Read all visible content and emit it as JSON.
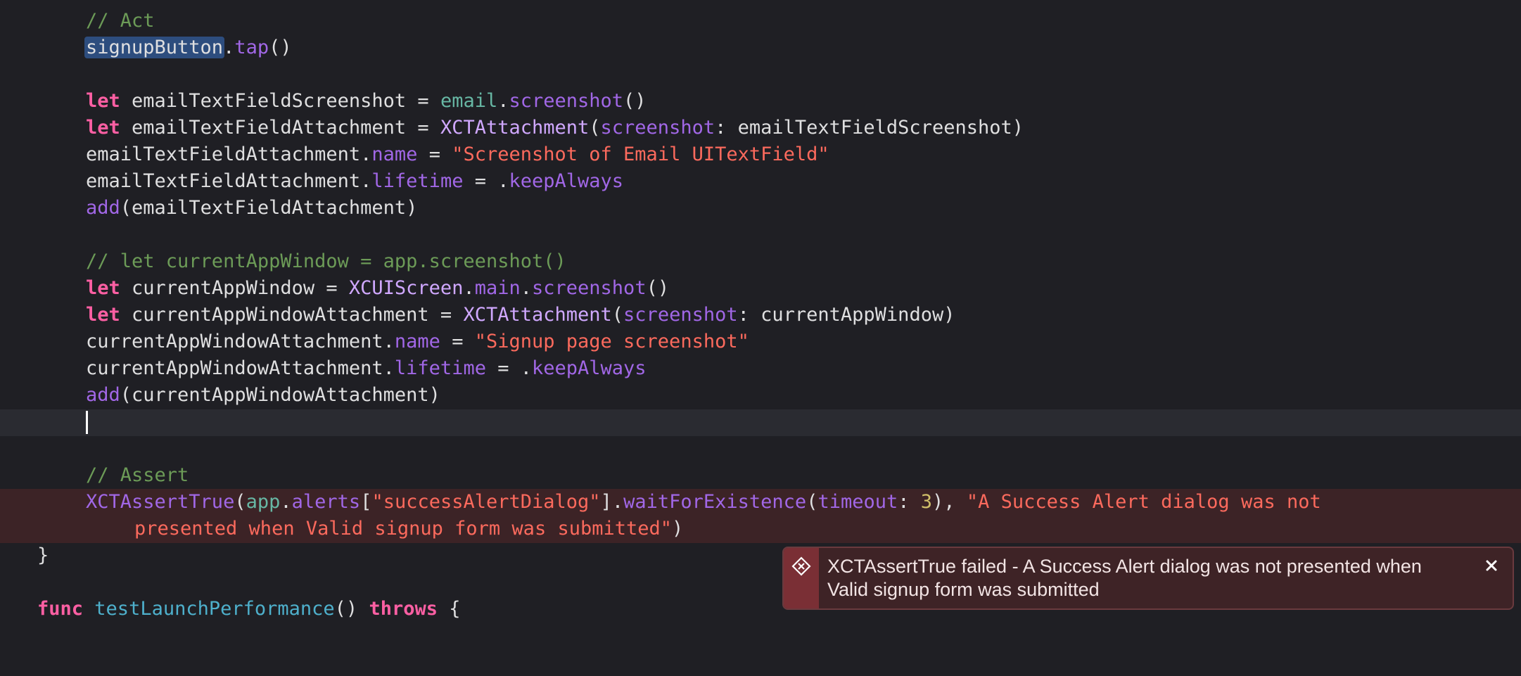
{
  "colors": {
    "background": "#1f1f24",
    "keyword": "#fc5fa3",
    "comment": "#6c9b57",
    "string": "#fc6a5d",
    "number": "#d0bf69",
    "type": "#d0a8ff",
    "property": "#a167e6",
    "error_band": "#3c2326"
  },
  "code": {
    "l1": {
      "comment": "// Act"
    },
    "l2": {
      "selected": "signupButton",
      "dot": ".",
      "method": "tap",
      "rest": "()"
    },
    "l4": {
      "kw": "let",
      "name": " emailTextFieldScreenshot = ",
      "obj": "email",
      "dot": ".",
      "method": "screenshot",
      "rest": "()"
    },
    "l5": {
      "kw": "let",
      "name": " emailTextFieldAttachment = ",
      "type": "XCTAttachment",
      "open": "(",
      "label": "screenshot",
      "rest": ": emailTextFieldScreenshot)"
    },
    "l6": {
      "obj": "emailTextFieldAttachment",
      "dot": ".",
      "prop": "name",
      "eq": " = ",
      "str": "\"Screenshot of Email UITextField\""
    },
    "l7": {
      "obj": "emailTextFieldAttachment",
      "dot": ".",
      "prop": "lifetime",
      "eq": " = .",
      "val": "keepAlways"
    },
    "l8": {
      "func": "add",
      "rest": "(emailTextFieldAttachment)"
    },
    "l10": {
      "comment": "// let currentAppWindow = app.screenshot()"
    },
    "l11": {
      "kw": "let",
      "name": " currentAppWindow = ",
      "type": "XCUIScreen",
      "dot": ".",
      "prop": "main",
      "dot2": ".",
      "method": "screenshot",
      "rest": "()"
    },
    "l12": {
      "kw": "let",
      "name": " currentAppWindowAttachment = ",
      "type": "XCTAttachment",
      "open": "(",
      "label": "screenshot",
      "rest": ": currentAppWindow)"
    },
    "l13": {
      "obj": "currentAppWindowAttachment",
      "dot": ".",
      "prop": "name",
      "eq": " = ",
      "str": "\"Signup page screenshot\""
    },
    "l14": {
      "obj": "currentAppWindowAttachment",
      "dot": ".",
      "prop": "lifetime",
      "eq": " = .",
      "val": "keepAlways"
    },
    "l15": {
      "func": "add",
      "rest": "(currentAppWindowAttachment)"
    },
    "l17": {
      "comment": "// Assert"
    },
    "l18": {
      "func": "XCTAssertTrue",
      "open": "(",
      "obj": "app",
      "dot": ".",
      "prop": "alerts",
      "br_open": "[",
      "key": "\"successAlertDialog\"",
      "br_close": "]",
      "dot2": ".",
      "method": "waitForExistence",
      "open2": "(",
      "label": "timeout",
      "colon": ": ",
      "num": "3",
      "close2": "), ",
      "msg1": "\"A Success Alert dialog was not"
    },
    "l19": {
      "msg2": "presented when Valid signup form was submitted\"",
      "close": ")"
    },
    "l20": {
      "brace": "}"
    },
    "l22": {
      "kw": "func",
      "sp": " ",
      "name": "testLaunchPerformance",
      "parens": "() ",
      "kw2": "throws",
      "brace": " {"
    }
  },
  "error": {
    "message": "XCTAssertTrue failed - A Success Alert dialog was not presented when Valid signup form was submitted",
    "icon": "error-x-icon",
    "close_icon": "close-icon"
  }
}
